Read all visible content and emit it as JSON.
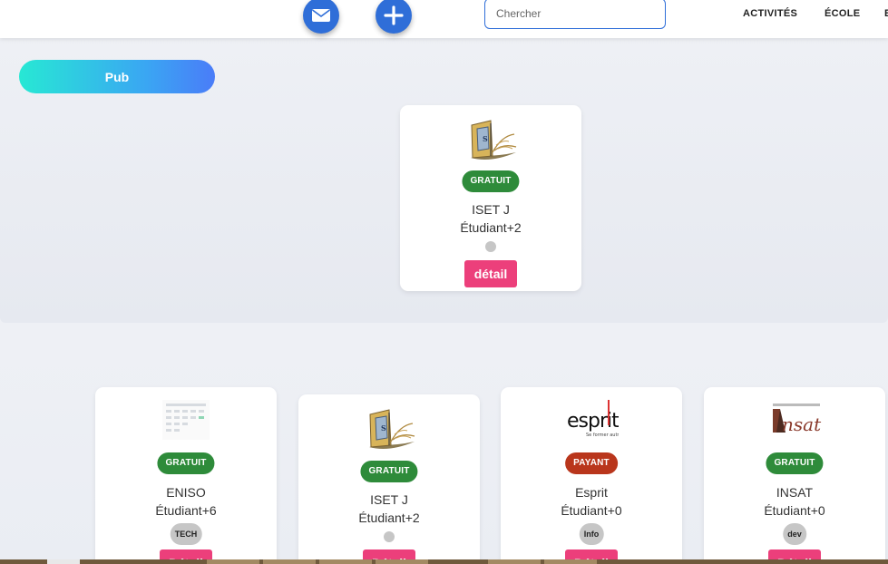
{
  "header": {
    "mail_icon": "envelope-icon",
    "add_icon": "plus-icon",
    "search_placeholder": "Chercher",
    "nav": [
      "ACTIVITÉS",
      "ÉCOLE",
      "E"
    ]
  },
  "pub": {
    "label": "Pub"
  },
  "featured": {
    "name": "ISET J",
    "students": "Étudiant+2",
    "badge": "GRATUIT",
    "button": "détail"
  },
  "cards": [
    {
      "name": "ENISO",
      "students": "Étudiant+6",
      "badge": "GRATUIT",
      "tag": "TECH",
      "button": "Détail"
    },
    {
      "name": "ISET J",
      "students": "Étudiant+2",
      "badge": "GRATUIT",
      "tag": "",
      "button": "Détail"
    },
    {
      "name": "Esprit",
      "students": "Étudiant+0",
      "badge": "PAYANT",
      "tag": "Info",
      "button": "Détail"
    },
    {
      "name": "INSAT",
      "students": "Étudiant+0",
      "badge": "GRATUIT",
      "tag": "dev",
      "button": "Détail"
    }
  ],
  "colors": {
    "primary": "#2f6ed8",
    "free": "#2e8b3a",
    "paid": "#b9361c",
    "detail": "#ec3f7b"
  }
}
